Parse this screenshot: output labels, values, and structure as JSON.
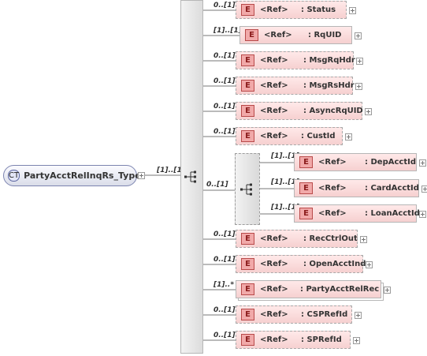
{
  "complex_type": {
    "badge": "CT",
    "name": "PartyAcctRelInqRs_Type"
  },
  "root_cardinality": "[1]..[1]",
  "ref_label": "<Ref>",
  "element_badge": "E",
  "elements": [
    {
      "name": ": Status",
      "card": "0..[1]"
    },
    {
      "name": ": RqUID",
      "card": "[1]..[1]"
    },
    {
      "name": ": MsgRqHdr",
      "card": "0..[1]"
    },
    {
      "name": ": MsgRsHdr",
      "card": "0..[1]"
    },
    {
      "name": ": AsyncRqUID",
      "card": "0..[1]"
    },
    {
      "name": ": CustId",
      "card": "0..[1]"
    },
    {
      "name": ": RecCtrlOut",
      "card": "0..[1]"
    },
    {
      "name": ": OpenAcctInd",
      "card": "0..[1]"
    },
    {
      "name": ": PartyAcctRelRec",
      "card": "[1]..*"
    },
    {
      "name": ": CSPRefId",
      "card": "0..[1]"
    },
    {
      "name": ": SPRefId",
      "card": "0..[1]"
    }
  ],
  "choice": {
    "card": "0..[1]",
    "items": [
      {
        "name": ": DepAcctId",
        "card": "[1]..[1]"
      },
      {
        "name": ": CardAcctId",
        "card": "[1]..[1]"
      },
      {
        "name": ": LoanAcctId",
        "card": "[1]..[1]"
      }
    ]
  }
}
